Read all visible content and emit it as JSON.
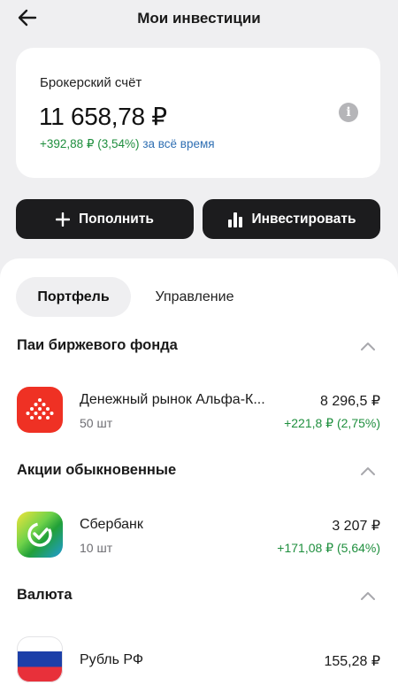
{
  "header": {
    "title": "Мои инвестиции",
    "back_icon": "arrow-left-icon"
  },
  "account": {
    "label": "Брокерский счёт",
    "balance_int": "11 658",
    "balance_dec": ",78 ₽",
    "gain": "+392,88 ₽ (3,54%)",
    "gain_period": "за всё время",
    "info_icon": "info-icon"
  },
  "actions": {
    "topup_label": "Пополнить",
    "invest_label": "Инвестировать"
  },
  "tabs": [
    {
      "label": "Портфель",
      "active": true
    },
    {
      "label": "Управление",
      "active": false
    }
  ],
  "sections": [
    {
      "title": "Паи биржевого фонда",
      "items": [
        {
          "name": "Денежный рынок Альфа-К...",
          "qty": "50 шт",
          "price": "8 296,5 ₽",
          "change": "+221,8 ₽ (2,75%)"
        }
      ]
    },
    {
      "title": "Акции обыкновенные",
      "items": [
        {
          "name": "Сбербанк",
          "qty": "10 шт",
          "price": "3 207 ₽",
          "change": "+171,08 ₽ (5,64%)"
        }
      ]
    },
    {
      "title": "Валюта",
      "items": [
        {
          "name": "Рубль РФ",
          "price": "155,28 ₽"
        }
      ]
    }
  ],
  "colors": {
    "positive": "#1f8f3e",
    "period": "#2f6fb3",
    "button_bg": "#1c1c1e",
    "alfa_red": "#ef3124",
    "sber_green": "#21a038"
  }
}
